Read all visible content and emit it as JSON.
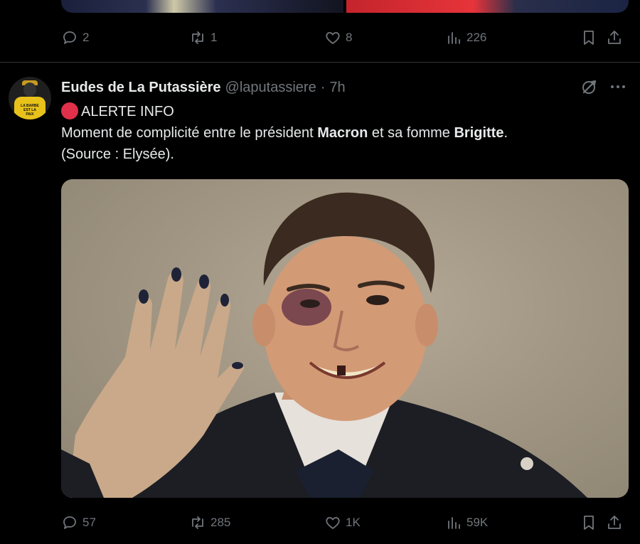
{
  "previous_tweet": {
    "actions": {
      "replies": "2",
      "reposts": "1",
      "likes": "8",
      "views": "226"
    }
  },
  "tweet": {
    "author_name": "Eudes de La Putassière",
    "handle": "@laputassiere",
    "separator": "·",
    "time": "7h",
    "avatar_text": "LA BARBE EST LA PAIX",
    "line1": "ALERTE INFO",
    "line2_part1": "Moment de complicité entre le président ",
    "line2_bold1": "Macron",
    "line2_part2": " et sa fomme ",
    "line2_bold2": "Brigitte",
    "line2_part3": ".",
    "line3": "(Source : Elysée).",
    "actions": {
      "replies": "57",
      "reposts": "285",
      "likes": "1K",
      "views": "59K"
    }
  },
  "icons": {
    "reply": "reply-icon",
    "repost": "repost-icon",
    "like": "heart-icon",
    "views": "views-icon",
    "bookmark": "bookmark-icon",
    "share": "share-icon",
    "grok": "grok-icon",
    "more": "more-icon"
  },
  "colors": {
    "background": "#000000",
    "text": "#e7e9ea",
    "muted": "#71767b",
    "alert_dot": "#e0304a",
    "divider": "#2f3336"
  }
}
